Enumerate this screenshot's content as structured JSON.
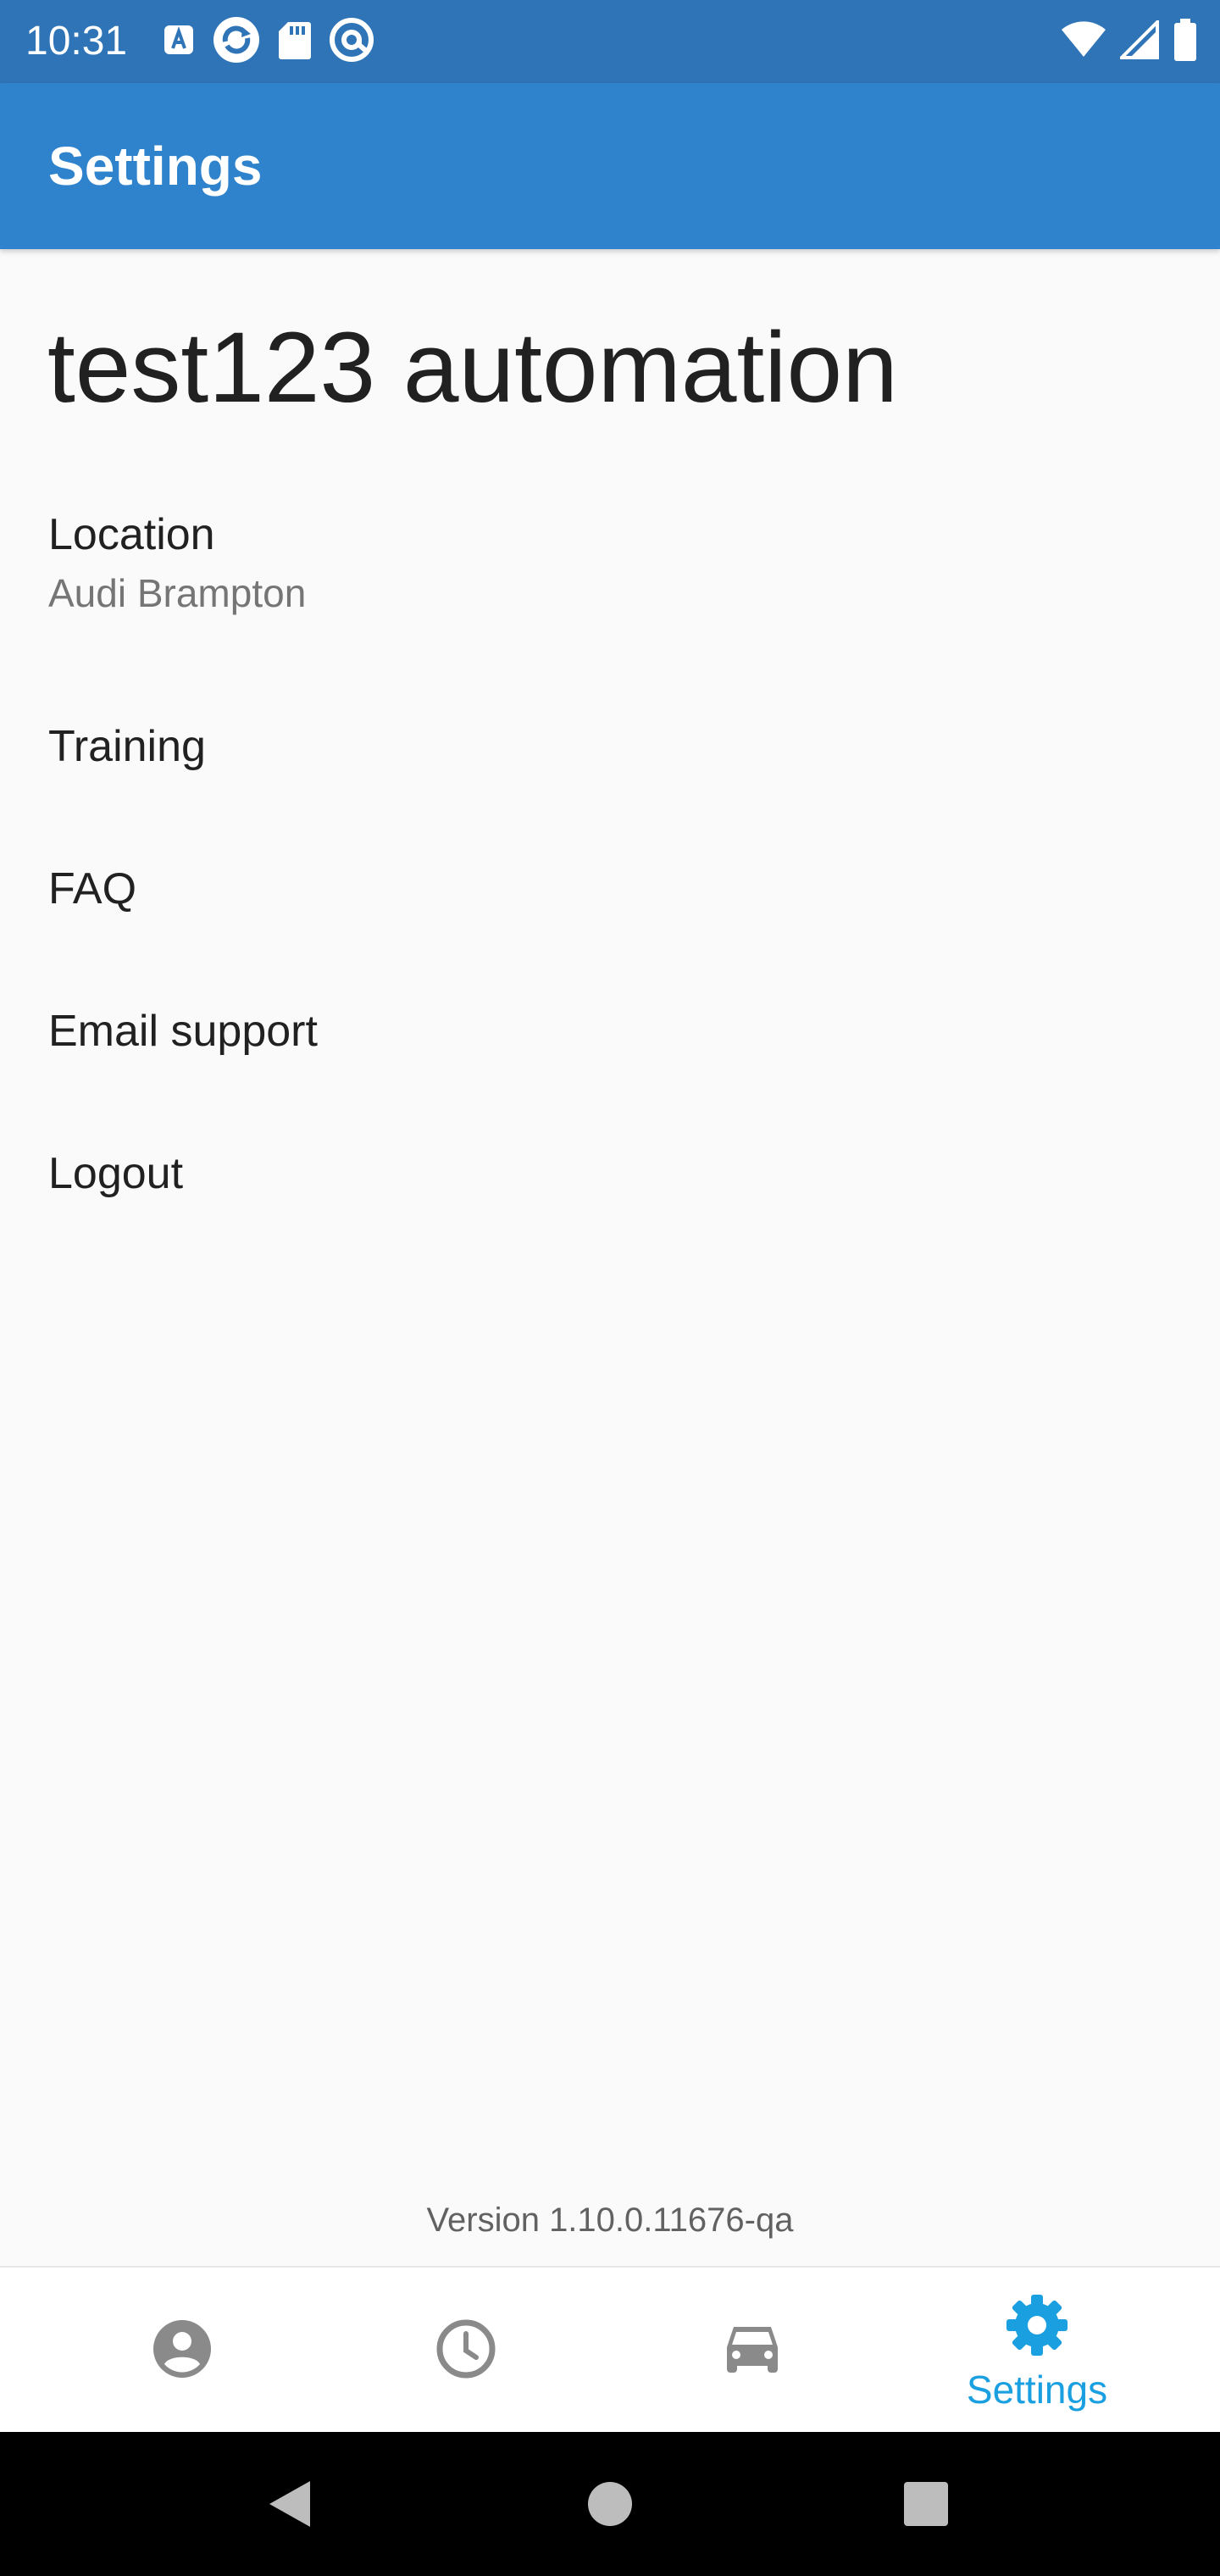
{
  "status_bar": {
    "time": "10:31",
    "left_icons": [
      "a-badge-icon",
      "sync-app-icon",
      "sd-card-icon",
      "at-sign-icon"
    ],
    "right_icons": [
      "wifi-icon",
      "cell-signal-icon",
      "battery-icon"
    ]
  },
  "app_bar": {
    "title": "Settings",
    "color": "#2e83cc"
  },
  "profile": {
    "name": "test123 automation"
  },
  "settings": {
    "location": {
      "label": "Location",
      "value": "Audi Brampton"
    },
    "training": {
      "label": "Training"
    },
    "faq": {
      "label": "FAQ"
    },
    "email_support": {
      "label": "Email support"
    },
    "logout": {
      "label": "Logout"
    }
  },
  "version": "Version 1.10.0.11676-qa",
  "bottom_nav": {
    "items": [
      {
        "icon": "account-icon",
        "label": ""
      },
      {
        "icon": "clock-icon",
        "label": ""
      },
      {
        "icon": "car-icon",
        "label": ""
      },
      {
        "icon": "gear-icon",
        "label": "Settings",
        "selected": true
      }
    ],
    "active_color": "#1a9fe0",
    "inactive_color": "#8a8a8a"
  },
  "system_nav": {
    "buttons": [
      "back-icon",
      "home-icon",
      "recents-icon"
    ]
  }
}
